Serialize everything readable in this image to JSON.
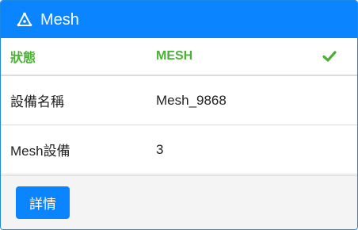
{
  "header": {
    "icon": "mesh-triangle-icon",
    "title": "Mesh"
  },
  "status_row": {
    "label": "狀態",
    "value": "MESH",
    "icon": "check-icon",
    "color": "#4caf37"
  },
  "rows": [
    {
      "label": "設備名稱",
      "value": "Mesh_9868"
    },
    {
      "label": "Mesh設備",
      "value": "3"
    }
  ],
  "footer": {
    "details_button": "詳情"
  },
  "colors": {
    "accent": "#0a84ff",
    "success": "#4caf37"
  }
}
